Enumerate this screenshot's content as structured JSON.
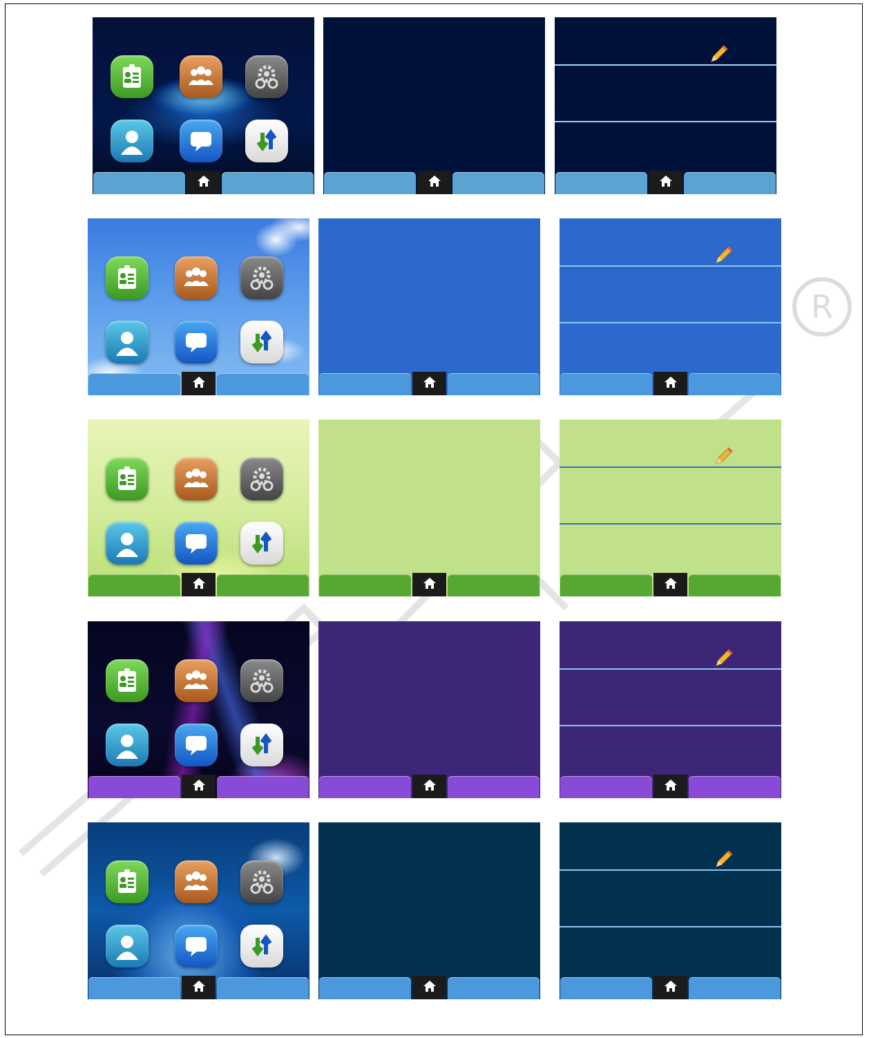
{
  "themes": [
    {
      "name": "dark-blue",
      "wallpaper": "blue-orbit",
      "screen_color": "#00113a",
      "softkey_color": "#5aa3d2",
      "line_color": "#9fd3ff"
    },
    {
      "name": "sky-blue",
      "wallpaper": "sky-clouds",
      "screen_color": "#2c69cc",
      "softkey_color": "#4c98dc",
      "line_color": "#8fc4f5"
    },
    {
      "name": "green",
      "wallpaper": "meadow",
      "screen_color": "#c1e08a",
      "softkey_color": "#56a832",
      "line_color": "#3b6fb3"
    },
    {
      "name": "purple",
      "wallpaper": "neon-lights",
      "screen_color": "#3d2678",
      "softkey_color": "#8a4ad8",
      "line_color": "#8fc4f5"
    },
    {
      "name": "navy",
      "wallpaper": "globe",
      "screen_color": "#02304f",
      "softkey_color": "#4c98dc",
      "line_color": "#8fc4f5"
    }
  ],
  "apps": [
    {
      "icon": "contacts-card-icon"
    },
    {
      "icon": "group-contacts-icon"
    },
    {
      "icon": "settings-gear-icon"
    },
    {
      "icon": "profile-icon"
    },
    {
      "icon": "message-icon"
    },
    {
      "icon": "transfer-arrows-icon"
    }
  ],
  "home_icon": "home-icon",
  "edit_icon": "pencil-icon",
  "watermark": "registered-mark"
}
